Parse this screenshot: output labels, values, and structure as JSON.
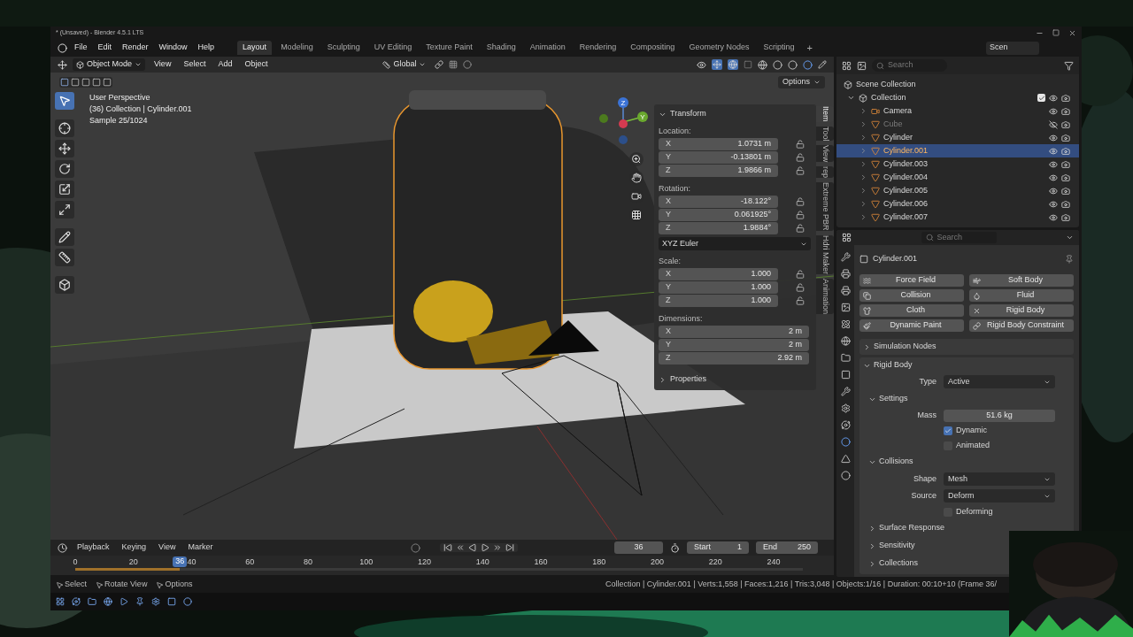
{
  "title_bar": {
    "title": "* (Unsaved) - Blender 4.5.1 LTS"
  },
  "menu": [
    "File",
    "Edit",
    "Render",
    "Window",
    "Help"
  ],
  "workspaces": [
    {
      "label": "Layout",
      "selected": true
    },
    {
      "label": "Modeling",
      "selected": false
    },
    {
      "label": "Sculpting",
      "selected": false
    },
    {
      "label": "UV Editing",
      "selected": false
    },
    {
      "label": "Texture Paint",
      "selected": false
    },
    {
      "label": "Shading",
      "selected": false
    },
    {
      "label": "Animation",
      "selected": false
    },
    {
      "label": "Rendering",
      "selected": false
    },
    {
      "label": "Compositing",
      "selected": false
    },
    {
      "label": "Geometry Nodes",
      "selected": false
    },
    {
      "label": "Scripting",
      "selected": false
    }
  ],
  "add_workspace": "+",
  "scene": {
    "label": "Scen"
  },
  "header": {
    "mode": "Object Mode",
    "menus": [
      "View",
      "Select",
      "Add",
      "Object"
    ],
    "orientation": "Global"
  },
  "viewport": {
    "options": "Options",
    "info": [
      "User Perspective",
      "(36) Collection | Cylinder.001",
      "Sample 25/1024"
    ],
    "axes": [
      "Z",
      "Y"
    ]
  },
  "sidebar": {
    "title": "Transform",
    "expanded": true,
    "groups": [
      {
        "label": "Location:",
        "locks": true,
        "rows": [
          {
            "axis": "X",
            "value": "1.0731 m"
          },
          {
            "axis": "Y",
            "value": "-0.13801 m"
          },
          {
            "axis": "Z",
            "value": "1.9866 m"
          }
        ]
      },
      {
        "label": "Rotation:",
        "locks": true,
        "rows": [
          {
            "axis": "X",
            "value": "-18.122°"
          },
          {
            "axis": "Y",
            "value": "0.061925°"
          },
          {
            "axis": "Z",
            "value": "1.9884°"
          }
        ],
        "mode": "XYZ Euler"
      },
      {
        "label": "Scale:",
        "locks": true,
        "rows": [
          {
            "axis": "X",
            "value": "1.000"
          },
          {
            "axis": "Y",
            "value": "1.000"
          },
          {
            "axis": "Z",
            "value": "1.000"
          }
        ]
      },
      {
        "label": "Dimensions:",
        "locks": false,
        "rows": [
          {
            "axis": "X",
            "value": "2 m"
          },
          {
            "axis": "Y",
            "value": "2 m"
          },
          {
            "axis": "Z",
            "value": "2.92 m"
          }
        ]
      }
    ],
    "properties": {
      "title": "Properties",
      "expanded": false
    }
  },
  "sidebar_tabs": [
    {
      "label": "Item",
      "selected": true
    },
    {
      "label": "Tool",
      "selected": false
    },
    {
      "label": "View",
      "selected": false
    },
    {
      "label": "rep",
      "selected": false
    },
    {
      "label": "Extreme PBR",
      "selected": false
    },
    {
      "label": "Hdri Maker",
      "selected": false
    },
    {
      "label": "Animation",
      "selected": false
    }
  ],
  "outliner": {
    "search": {
      "placeholder": "Search"
    },
    "root": "Scene Collection",
    "collection": {
      "name": "Collection",
      "expanded": true,
      "included": true
    },
    "items": [
      {
        "name": "Camera",
        "kind": "camera",
        "selected": false,
        "visible": true
      },
      {
        "name": "Cube",
        "kind": "mesh",
        "selected": false,
        "visible": false
      },
      {
        "name": "Cylinder",
        "kind": "mesh",
        "selected": false,
        "visible": true
      },
      {
        "name": "Cylinder.001",
        "kind": "mesh",
        "selected": true,
        "visible": true
      },
      {
        "name": "Cylinder.003",
        "kind": "mesh",
        "selected": false,
        "visible": true
      },
      {
        "name": "Cylinder.004",
        "kind": "mesh",
        "selected": false,
        "visible": true
      },
      {
        "name": "Cylinder.005",
        "kind": "mesh",
        "selected": false,
        "visible": true
      },
      {
        "name": "Cylinder.006",
        "kind": "mesh",
        "selected": false,
        "visible": true
      },
      {
        "name": "Cylinder.007",
        "kind": "mesh",
        "selected": false,
        "visible": true
      }
    ]
  },
  "properties": {
    "search": {
      "placeholder": "Search"
    },
    "object": "Cylinder.001",
    "physics": [
      {
        "label": "Force Field",
        "enabled": false
      },
      {
        "label": "Soft Body",
        "enabled": false
      },
      {
        "label": "Collision",
        "enabled": false
      },
      {
        "label": "Fluid",
        "enabled": false
      },
      {
        "label": "Cloth",
        "enabled": false
      },
      {
        "label": "Rigid Body",
        "enabled": true
      },
      {
        "label": "Dynamic Paint",
        "enabled": false
      },
      {
        "label": "Rigid Body Constraint",
        "enabled": false
      }
    ],
    "panels": [
      {
        "title": "Simulation Nodes",
        "expanded": false
      },
      {
        "title": "Rigid Body",
        "expanded": true,
        "rows": [
          {
            "kind": "dropdown",
            "label": "Type",
            "value": "Active"
          },
          {
            "kind": "subpanel",
            "title": "Settings",
            "expanded": true,
            "children": [
              {
                "kind": "number",
                "label": "Mass",
                "value": "51.6 kg"
              },
              {
                "kind": "checkbox",
                "label": "Dynamic",
                "checked": true
              },
              {
                "kind": "checkbox",
                "label": "Animated",
                "checked": false
              }
            ]
          },
          {
            "kind": "subpanel",
            "title": "Collisions",
            "expanded": true,
            "children": [
              {
                "kind": "dropdown",
                "label": "Shape",
                "value": "Mesh"
              },
              {
                "kind": "dropdown",
                "label": "Source",
                "value": "Deform"
              },
              {
                "kind": "checkbox",
                "label": "Deforming",
                "checked": false
              },
              {
                "kind": "subpanel",
                "title": "Surface Response",
                "expanded": false
              },
              {
                "kind": "subpanel",
                "title": "Sensitivity",
                "expanded": false
              },
              {
                "kind": "subpanel",
                "title": "Collections",
                "expanded": false
              }
            ]
          }
        ]
      }
    ]
  },
  "timeline": {
    "menus": [
      "Playback",
      "Keying",
      "View",
      "Marker"
    ],
    "frame": "36",
    "start_label": "Start",
    "start": "1",
    "end_label": "End",
    "end": "250",
    "playhead": {
      "label": "36",
      "level": 0.144
    },
    "ticks": [
      "0",
      "20",
      "40",
      "60",
      "80",
      "100",
      "120",
      "140",
      "160",
      "180",
      "200",
      "220",
      "240"
    ]
  },
  "status_bar": {
    "hints": [
      "Select",
      "Rotate View",
      "Options"
    ],
    "stats": "Collection | Cylinder.001 | Verts:1,558 | Faces:1,216 | Tris:3,048 | Objects:1/16 | Duration: 00:10+10 (Frame 36/"
  }
}
